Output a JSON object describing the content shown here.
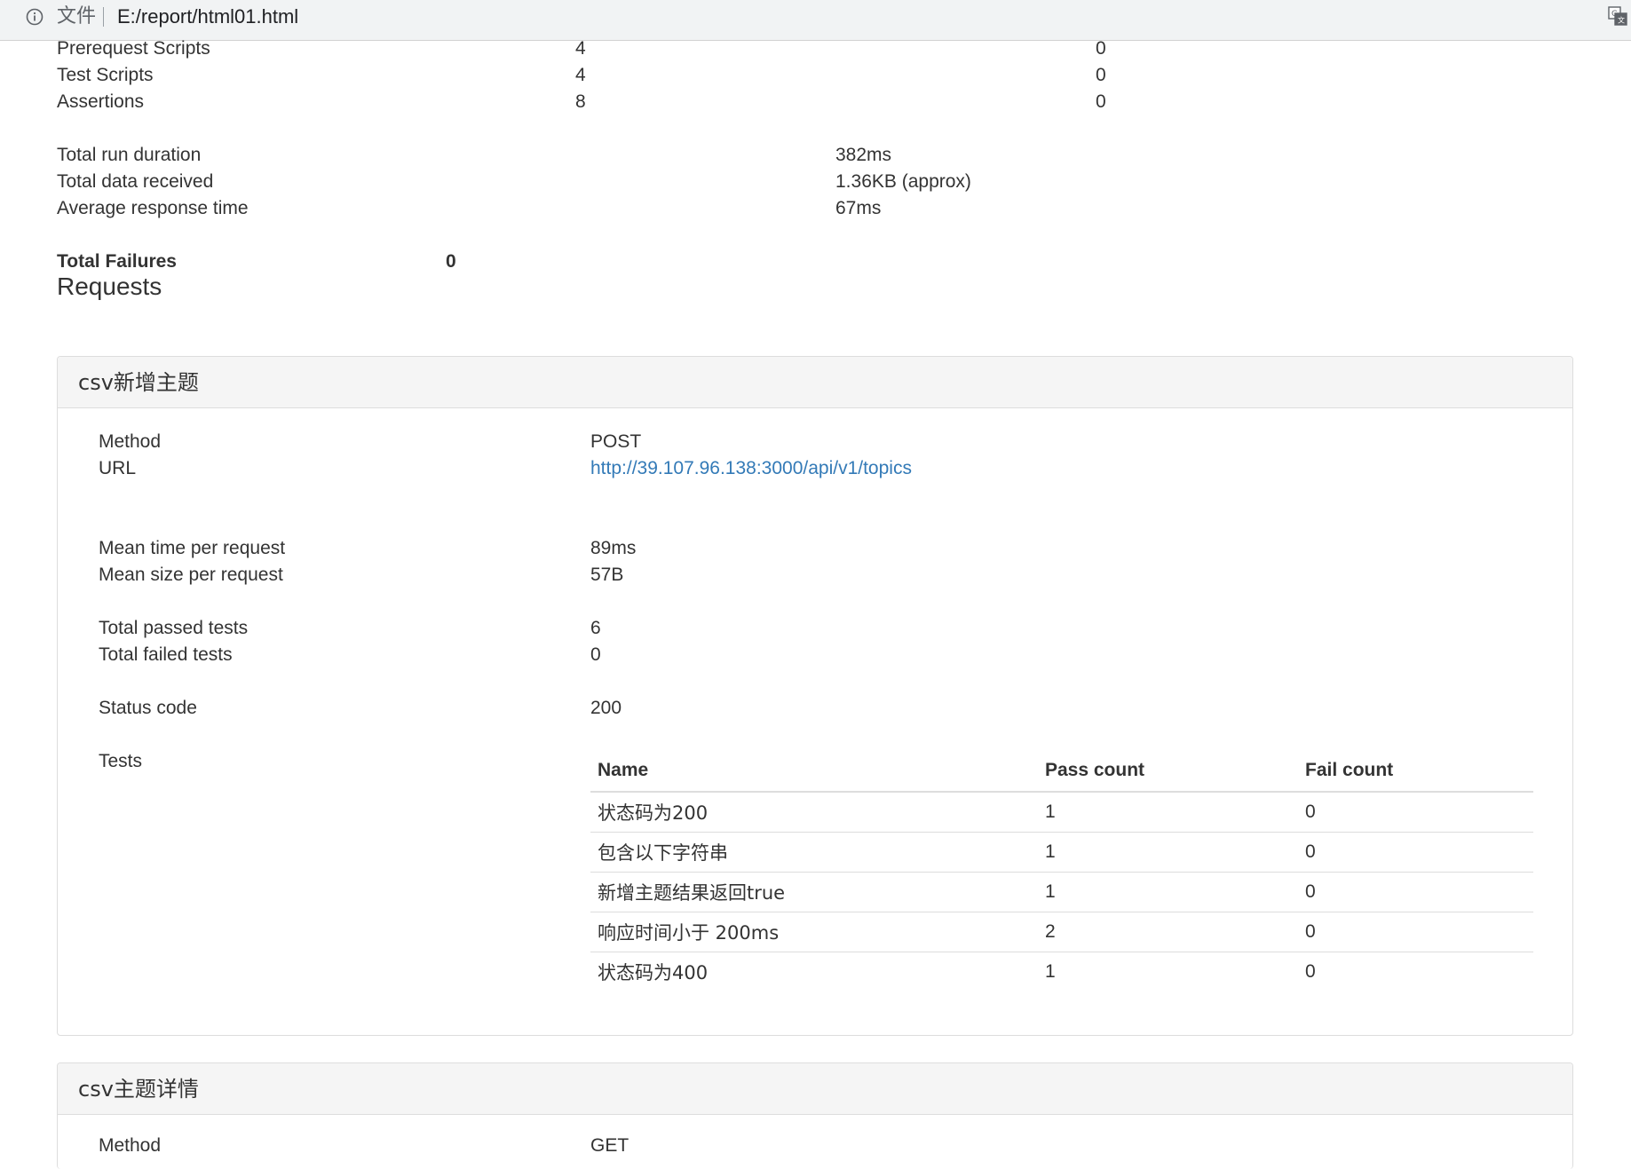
{
  "browser": {
    "scheme_label": "文件",
    "url": "E:/report/html01.html",
    "info_icon": "info-icon",
    "translate_icon": "translate-icon"
  },
  "summary_rows": [
    {
      "label": "Prerequest Scripts",
      "total": "4",
      "failed": "0"
    },
    {
      "label": "Test Scripts",
      "total": "4",
      "failed": "0"
    },
    {
      "label": "Assertions",
      "total": "8",
      "failed": "0"
    }
  ],
  "run_stats": [
    {
      "label": "Total run duration",
      "value": "382ms"
    },
    {
      "label": "Total data received",
      "value": "1.36KB (approx)"
    },
    {
      "label": "Average response time",
      "value": "67ms"
    }
  ],
  "total_failures": {
    "label": "Total Failures",
    "value": "0"
  },
  "requests_heading": "Requests",
  "requests": [
    {
      "title": "csv新增主题",
      "method_label": "Method",
      "method": "POST",
      "url_label": "URL",
      "url": "http://39.107.96.138:3000/api/v1/topics",
      "mean_time_label": "Mean time per request",
      "mean_time": "89ms",
      "mean_size_label": "Mean size per request",
      "mean_size": "57B",
      "passed_label": "Total passed tests",
      "passed": "6",
      "failed_label": "Total failed tests",
      "failed": "0",
      "status_label": "Status code",
      "status": "200",
      "tests_label": "Tests",
      "tests_columns": [
        "Name",
        "Pass count",
        "Fail count"
      ],
      "tests": [
        {
          "name": "状态码为200",
          "pass": "1",
          "fail": "0"
        },
        {
          "name": "包含以下字符串",
          "pass": "1",
          "fail": "0"
        },
        {
          "name": "新增主题结果返回true",
          "pass": "1",
          "fail": "0"
        },
        {
          "name": "响应时间小于 200ms",
          "pass": "2",
          "fail": "0"
        },
        {
          "name": "状态码为400",
          "pass": "1",
          "fail": "0"
        }
      ]
    },
    {
      "title": "csv主题详情",
      "method_label": "Method",
      "method": "GET"
    }
  ]
}
